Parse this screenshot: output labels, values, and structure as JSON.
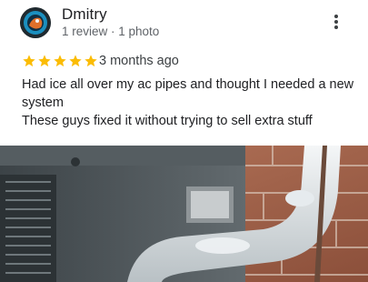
{
  "review": {
    "author": "Dmitry",
    "author_meta": "1 review · 1 photo",
    "rating": 5,
    "rating_max": 5,
    "date": "3 months ago",
    "text_lines": [
      "Had ice all over my ac pipes and thought I needed a new system",
      "These guys fixed it without trying to sell extra stuff"
    ],
    "star_color": "#fbbc04",
    "photo_subject": "frozen-ac-unit-pipes-photo"
  }
}
